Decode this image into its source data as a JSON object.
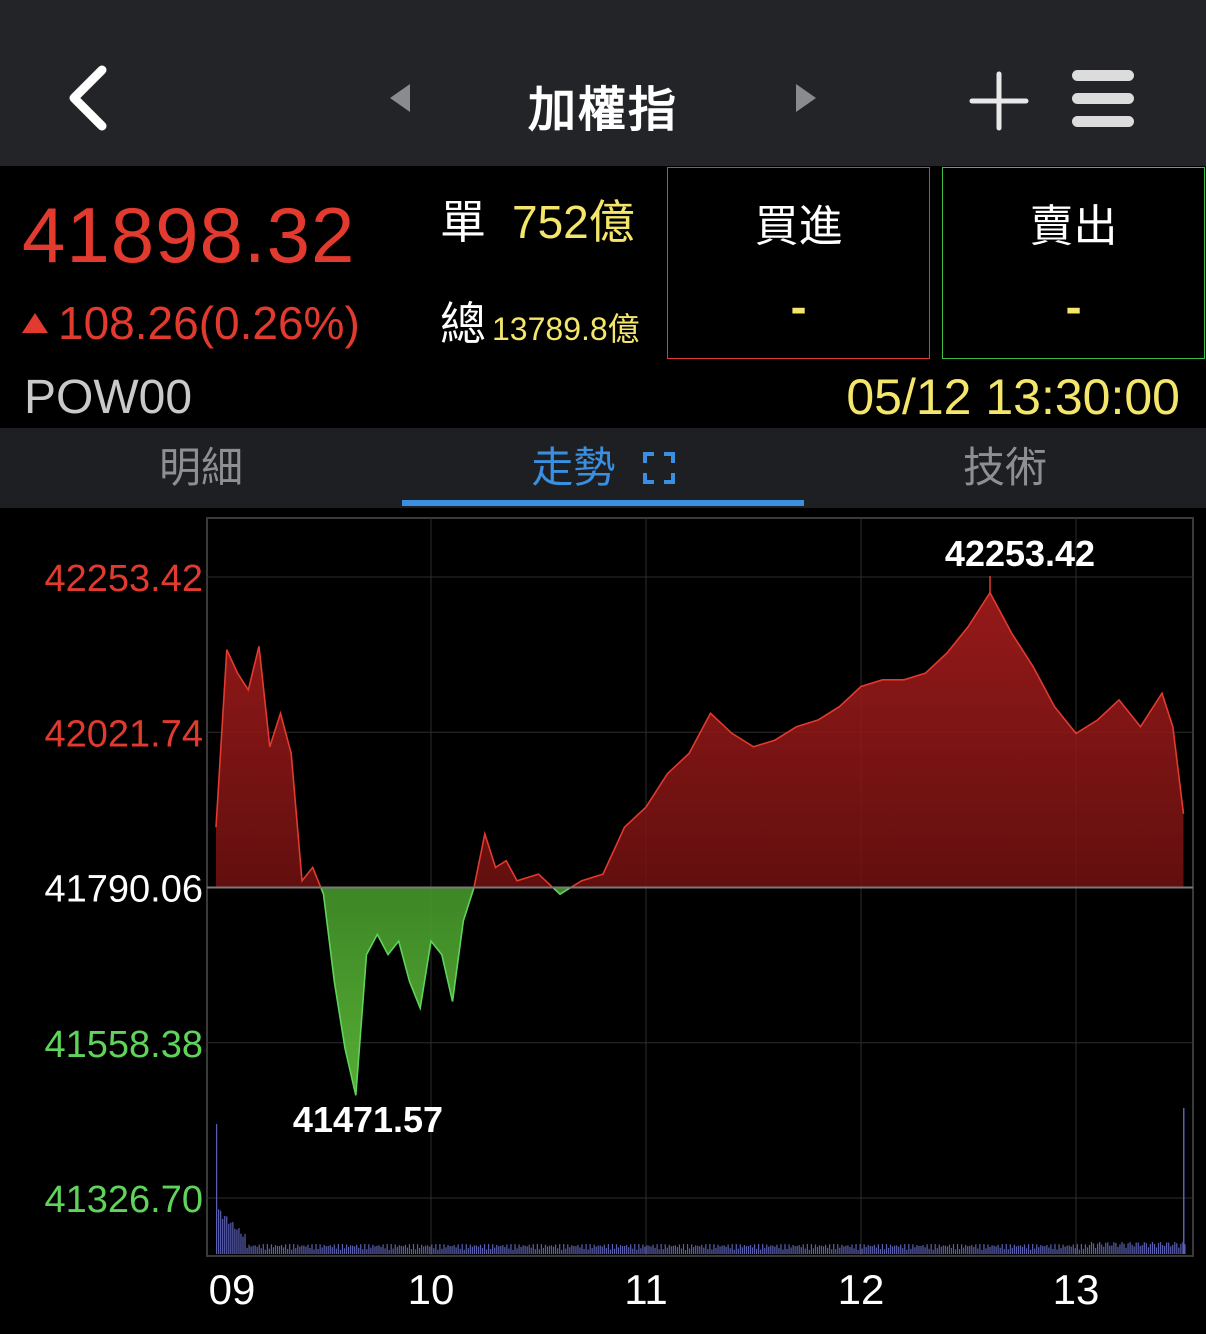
{
  "header": {
    "title": "加權指"
  },
  "quote": {
    "price": "41898.32",
    "change": "108.26(0.26%)",
    "symbol": "POW00",
    "single_label": "單",
    "single_value": "752",
    "unit": "億",
    "total_label": "總",
    "total_value": "13789.8",
    "buy_label": "買進",
    "buy_value": "-",
    "sell_label": "賣出",
    "sell_value": "-",
    "datetime": "05/12 13:30:00"
  },
  "tabs": [
    {
      "label": "明細",
      "active": false
    },
    {
      "label": "走勢",
      "active": true
    },
    {
      "label": "技術",
      "active": false
    }
  ],
  "colors": {
    "up": "#e23a2e",
    "down": "#3fbf3f",
    "accent": "#3a8fe0",
    "volume_text": "#f3e66a"
  },
  "chart_data": {
    "type": "area",
    "reference": 41790.06,
    "y_ticks": [
      "42253.42",
      "42021.74",
      "41790.06",
      "41558.38",
      "41326.70"
    ],
    "ylim": [
      41326.7,
      42253.42
    ],
    "x_ticks": [
      "09",
      "10",
      "11",
      "12",
      "13"
    ],
    "high_label": "42253.42",
    "low_label": "41471.57",
    "series": [
      {
        "x": [
          9.0,
          9.05,
          9.1,
          9.15,
          9.2,
          9.25,
          9.3,
          9.35,
          9.4,
          9.45,
          9.5,
          9.55,
          9.6,
          9.65,
          9.7,
          9.75,
          9.8,
          9.85,
          9.9,
          9.95,
          10.0,
          10.05,
          10.1,
          10.15,
          10.2,
          10.25,
          10.3,
          10.35,
          10.4,
          10.5,
          10.6,
          10.7,
          10.8,
          10.9,
          11.0,
          11.1,
          11.2,
          11.3,
          11.4,
          11.5,
          11.6,
          11.7,
          11.8,
          11.9,
          12.0,
          12.1,
          12.2,
          12.3,
          12.4,
          12.5,
          12.6,
          12.7,
          12.8,
          12.9,
          13.0,
          13.1,
          13.2,
          13.3,
          13.4,
          13.45,
          13.5
        ],
        "values": [
          41880,
          42145,
          42110,
          42085,
          42150,
          42000,
          42050,
          41990,
          41800,
          41820,
          41780,
          41650,
          41550,
          41480,
          41690,
          41720,
          41690,
          41710,
          41650,
          41610,
          41710,
          41690,
          41620,
          41740,
          41790,
          41870,
          41820,
          41830,
          41800,
          41810,
          41780,
          41800,
          41810,
          41880,
          41910,
          41960,
          41990,
          42050,
          42020,
          42000,
          42010,
          42030,
          42040,
          42060,
          42090,
          42100,
          42100,
          42110,
          42140,
          42180,
          42230,
          42170,
          42120,
          42060,
          42020,
          42040,
          42070,
          42030,
          42080,
          42030,
          41900
        ]
      }
    ]
  }
}
